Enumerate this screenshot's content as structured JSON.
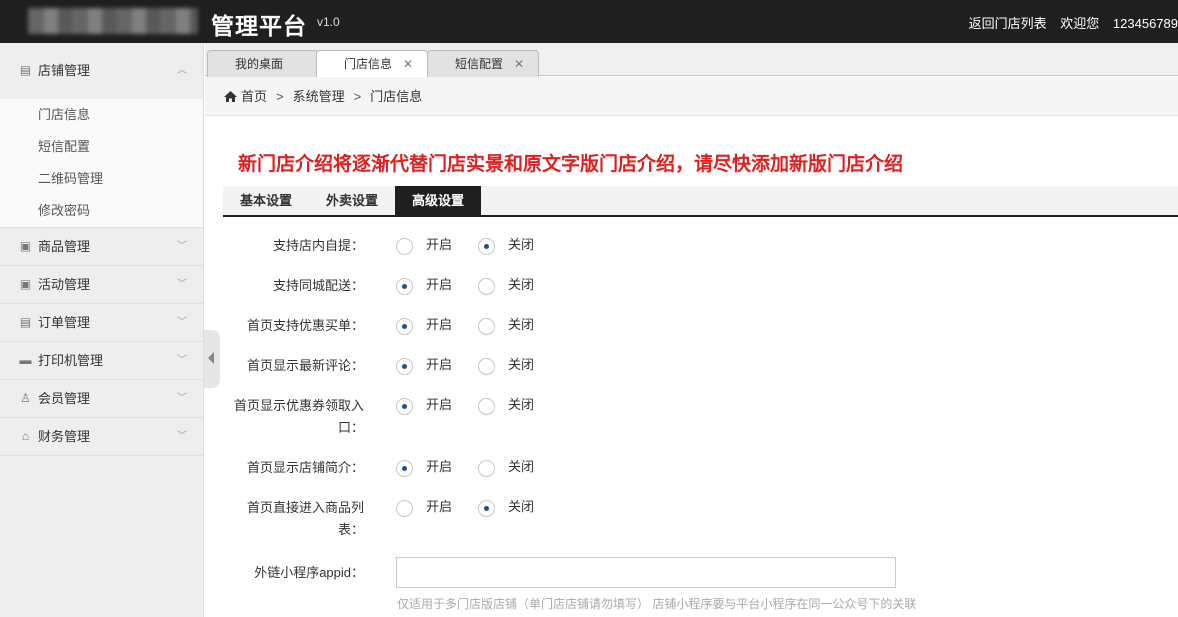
{
  "header": {
    "title": "管理平台",
    "version": "v1.0",
    "back_link": "返回门店列表",
    "welcome": "欢迎您",
    "username": "123456789"
  },
  "sidebar": {
    "groups": [
      {
        "label": "店铺管理",
        "icon": "store-icon",
        "expanded": true,
        "items": [
          "门店信息",
          "短信配置",
          "二维码管理",
          "修改密码"
        ]
      },
      {
        "label": "商品管理",
        "icon": "image-icon"
      },
      {
        "label": "活动管理",
        "icon": "image-icon"
      },
      {
        "label": "订单管理",
        "icon": "document-icon"
      },
      {
        "label": "打印机管理",
        "icon": "printer-icon"
      },
      {
        "label": "会员管理",
        "icon": "user-icon"
      },
      {
        "label": "财务管理",
        "icon": "bank-icon"
      }
    ]
  },
  "tabs": [
    {
      "label": "我的桌面",
      "closable": false
    },
    {
      "label": "门店信息",
      "closable": true,
      "active": true
    },
    {
      "label": "短信配置",
      "closable": true
    }
  ],
  "breadcrumb": [
    "首页",
    "系统管理",
    "门店信息"
  ],
  "notice": "新门店介绍将逐渐代替门店实景和原文字版门店介绍，请尽快添加新版门店介绍",
  "subtabs": [
    {
      "label": "基本设置"
    },
    {
      "label": "外卖设置"
    },
    {
      "label": "高级设置",
      "active": true
    }
  ],
  "options": {
    "on": "开启",
    "off": "关闭"
  },
  "settings": [
    {
      "label_line1": "支持店内自提：",
      "label_line2": "",
      "value": "off"
    },
    {
      "label_line1": "支持同城配送：",
      "label_line2": "",
      "value": "on"
    },
    {
      "label_line1": "首页支持优惠买单：",
      "label_line2": "",
      "value": "on"
    },
    {
      "label_line1": "首页显示最新评论：",
      "label_line2": "",
      "value": "on"
    },
    {
      "label_line1": "首页显示优惠券领取入",
      "label_line2": "口：",
      "value": "on"
    },
    {
      "label_line1": "首页显示店铺简介：",
      "label_line2": "",
      "value": "on"
    },
    {
      "label_line1": "首页直接进入商品列",
      "label_line2": "表：",
      "value": "off"
    }
  ],
  "appid": {
    "label": "外链小程序appid：",
    "value": "",
    "hint": "仅适用于多门店版店铺（单门店店铺请勿填写） 店铺小程序要与平台小程序在同一公众号下的关联"
  },
  "colors": {
    "accent": "#1f1f1f",
    "notice": "#e02020",
    "radio_dot": "#1b4f8a"
  }
}
